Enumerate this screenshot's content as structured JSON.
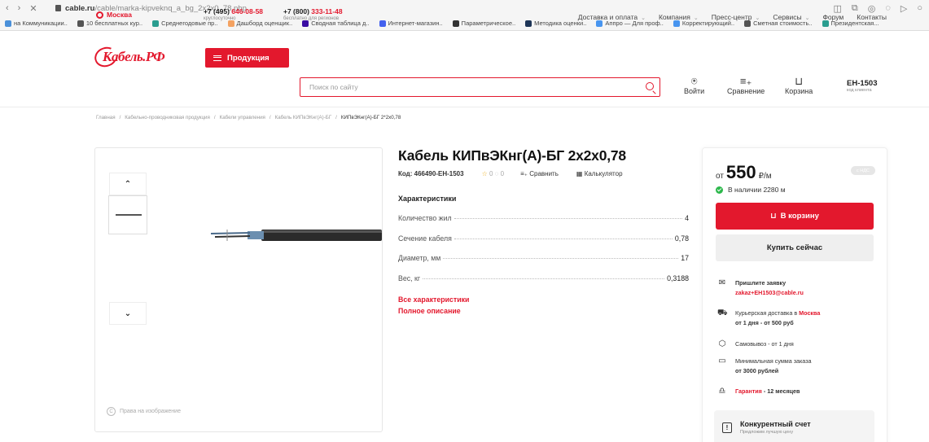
{
  "browser": {
    "url_domain": "cable.ru",
    "url_path": "/cable/marka-kipveknq_a_bg_2x2x0_78.php",
    "bookmarks": [
      {
        "label": "на Коммуникации..",
        "color": "#4a90d9"
      },
      {
        "label": "10 бесплатных кур..",
        "color": "#555555"
      },
      {
        "label": "Среднегодовые пр..",
        "color": "#2a9d8f"
      },
      {
        "label": "Дашборд оценщик..",
        "color": "#f4a261"
      },
      {
        "label": "Сводная таблица д..",
        "color": "#3a0ca3"
      },
      {
        "label": "Интернет-магазин..",
        "color": "#4361ee"
      },
      {
        "label": "Параметрическое..",
        "color": "#333333"
      },
      {
        "label": "Методика оценки..",
        "color": "#1d3557"
      },
      {
        "label": "Аппро — Для проф..",
        "color": "#4895ef"
      },
      {
        "label": "Корректирующий..",
        "color": "#4895ef"
      },
      {
        "label": "Сметная стоимость..",
        "color": "#555555"
      },
      {
        "label": "Президентская...",
        "color": "#2a9d8f"
      }
    ]
  },
  "header": {
    "city": "Москва",
    "phone1_prefix": "+7 (495) ",
    "phone1_red": "646-08-58",
    "phone1_note": "круглосуточно",
    "phone2_prefix": "+7 (800) ",
    "phone2_red": "333-11-48",
    "phone2_note": "бесплатно для регионов",
    "menu": [
      {
        "label": "Доставка и оплата",
        "chevron": true
      },
      {
        "label": "Компания",
        "chevron": true
      },
      {
        "label": "Пресс-центр",
        "chevron": true
      },
      {
        "label": "Сервисы",
        "chevron": true
      },
      {
        "label": "Форум",
        "chevron": false
      },
      {
        "label": "Контакты",
        "chevron": false
      }
    ],
    "logo_text": "Кабель.РФ",
    "products_label": "Продукция",
    "search_placeholder": "Поиск по сайту",
    "login_label": "Войти",
    "compare_label": "Сравнение",
    "cart_label": "Корзина",
    "part_number": "ЕН-1503",
    "part_number_note": "код клиента"
  },
  "breadcrumbs": [
    "Главная",
    "/",
    "Кабельно-проводниковая продукция",
    "/",
    "Кабели управления",
    "/",
    "Кабель КИПвЭКнг(А)-БГ",
    "/",
    "КИПвЭКнг(А)-БГ 2*2х0,78"
  ],
  "gallery": {
    "rights_label": "Права на изображение"
  },
  "product": {
    "title": "Кабель КИПвЭКнг(А)-БГ 2х2х0,78",
    "code": "Код: 466490-ЕН-1503",
    "rating": "0",
    "comments": "0",
    "compare_label": "Сравнить",
    "calc_label": "Калькулятор",
    "specs_heading": "Характеристики",
    "specs": [
      {
        "label": "Количество жил",
        "value": "4"
      },
      {
        "label": "Сечение кабеля",
        "value": "0,78"
      },
      {
        "label": "Диаметр, мм",
        "value": "17"
      },
      {
        "label": "Вес, кг",
        "value": "0,3188"
      }
    ],
    "all_specs_link": "Все характеристики",
    "full_desc_link": "Полное описание"
  },
  "buy": {
    "price_prefix": "от",
    "price": "550",
    "price_unit": "₽/м",
    "vat_badge": "с НДС",
    "stock": "В наличии 2280 м",
    "add_to_cart": "В корзину",
    "buy_now": "Купить сейчас",
    "request_line1": "Пришлите заявку",
    "request_email": "zakaz+EH1503@cable.ru",
    "delivery_line1": "Курьерская доставка в ",
    "delivery_city": "Москва",
    "delivery_line2": "от 1 дня - от 500 руб",
    "pickup": "Самовывоз - от 1 дня",
    "min_order_line1": "Минимальная сумма заказа",
    "min_order_line2": "от 3000 рублей",
    "warranty_link": "Гарантия",
    "warranty_rest": " - 12 месяцев",
    "competitive_title": "Конкурентный счет",
    "competitive_sub": "Предложим лучшую цену"
  },
  "colors": {
    "brand_red": "#e3182d",
    "stock_green": "#2db84c"
  }
}
